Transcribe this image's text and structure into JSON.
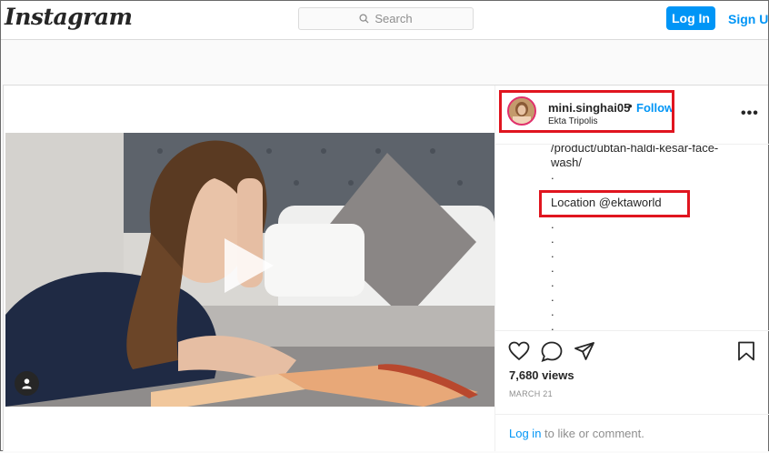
{
  "topbar": {
    "logo": "Instagram",
    "search_placeholder": "Search",
    "login_label": "Log In",
    "signup_label": "Sign Up"
  },
  "post": {
    "username": "mini.singhai05",
    "separator": "•",
    "follow_label": "Follow",
    "location": "Ekta Tripolis",
    "caption_lines": [
      "/product/ubtan-haldi-kesar-face-",
      "wash/",
      ".",
      "Location @ektaworld",
      ".",
      ".",
      ".",
      ".",
      ".",
      ".",
      ".",
      "."
    ],
    "views": "7,680 views",
    "date": "MARCH 21",
    "login_prompt_link": "Log in",
    "login_prompt_rest": " to like or comment."
  },
  "colors": {
    "accent": "#0095f6",
    "highlight": "#e0151f",
    "text": "#262626",
    "muted": "#8e8e8e"
  }
}
